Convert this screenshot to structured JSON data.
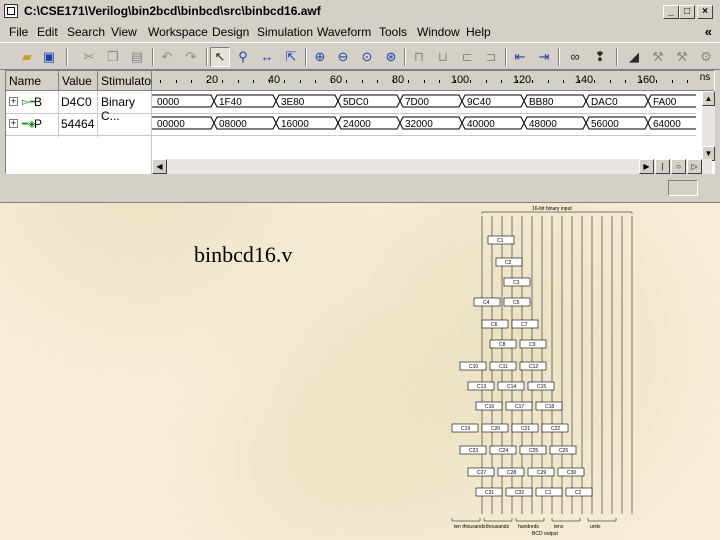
{
  "window": {
    "title": "C:\\CSE171\\Verilog\\bin2bcd\\binbcd\\src\\binbcd16.awf"
  },
  "menu": [
    "File",
    "Edit",
    "Search",
    "View",
    "Workspace",
    "Design",
    "Simulation",
    "Waveform",
    "Tools",
    "Window",
    "Help"
  ],
  "menu_more": "«",
  "toolbar": {
    "icons": [
      "open-folder-icon",
      "save-icon",
      "cut-icon",
      "copy-icon",
      "paste-icon",
      "undo-icon",
      "redo-icon",
      "pointer-icon",
      "zoom-icon",
      "measure-icon",
      "select-range-icon",
      "zoom-in-icon",
      "zoom-out-icon",
      "zoom-fit-icon",
      "zoom-area-icon",
      "bus-icon",
      "edge-icon",
      "stim-icon",
      "signal-icon",
      "search-icon",
      "binoculars-icon",
      "find-next-icon",
      "probe-icon",
      "breakpoint-icon",
      "tools-icon"
    ]
  },
  "waveform": {
    "headers": {
      "name": "Name",
      "value": "Value",
      "stimulator": "Stimulator"
    },
    "time_unit": "ns",
    "ruler_labels": [
      "20",
      "40",
      "60",
      "80",
      "100",
      "120",
      "140",
      "160"
    ],
    "signals": [
      {
        "name": "B",
        "value": "D4C0",
        "stimulator": "Binary C...",
        "segments": [
          "0000",
          "1F40",
          "3E80",
          "5DC0",
          "7D00",
          "9C40",
          "BB80",
          "DAC0",
          "FA00"
        ]
      },
      {
        "name": "P",
        "value": "54464",
        "stimulator": "",
        "segments": [
          "00000",
          "08000",
          "16000",
          "24000",
          "32000",
          "40000",
          "48000",
          "56000",
          "64000"
        ]
      }
    ],
    "hscroll_buttons": [
      "◀",
      "▶",
      "|",
      "○",
      "▷"
    ]
  },
  "slide": {
    "title": "binbcd16.v"
  },
  "diagram": {
    "header": "16-bit binary input",
    "cells_row1": [
      "C1",
      "C2",
      "C3",
      "C4",
      "C5",
      "C6",
      "C7",
      "C8",
      "C9",
      "C10",
      "C11",
      "C12",
      "C13",
      "C14",
      "C15",
      "C16",
      "C17",
      "C18",
      "C19",
      "C20",
      "C21",
      "C22",
      "C23",
      "C24",
      "C25",
      "C26",
      "C27",
      "C28",
      "C29",
      "C30",
      "C31",
      "C32"
    ],
    "output_groups": [
      "ten thousands",
      "thousands",
      "hundreds",
      "tens",
      "units"
    ],
    "footer": "BCD output"
  }
}
